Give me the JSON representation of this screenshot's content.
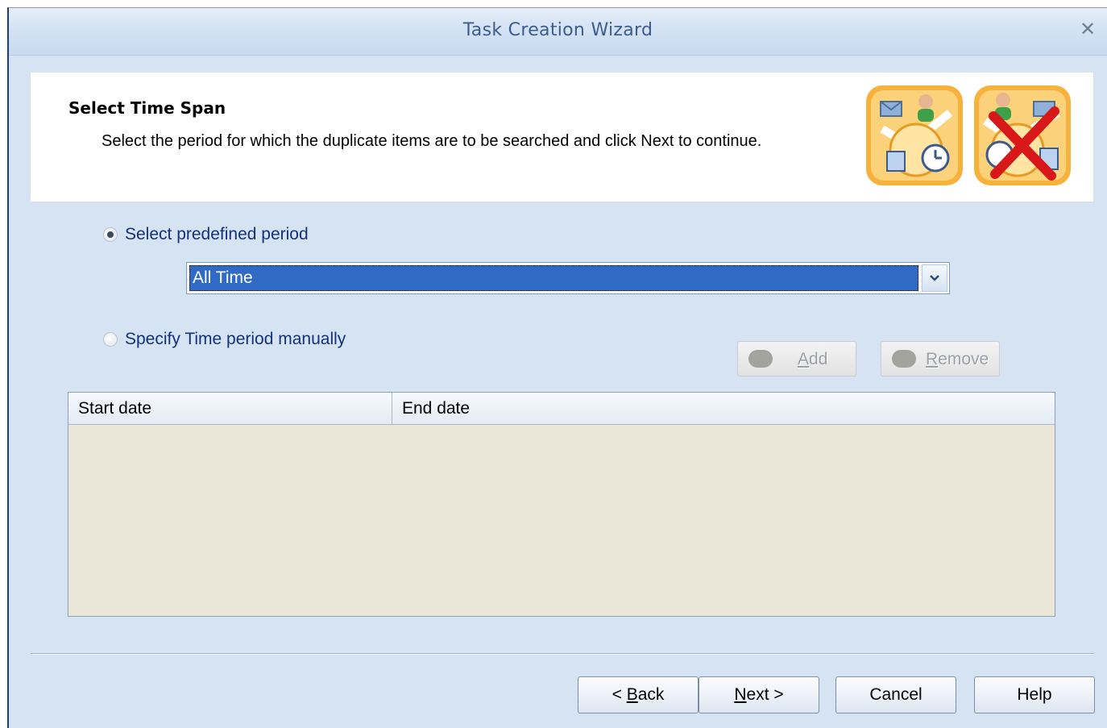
{
  "window": {
    "title": "Task Creation Wizard",
    "close_glyph": "✕"
  },
  "header": {
    "title": "Select Time Span",
    "description": "Select the period for which the duplicate items are to be searched and click Next to continue."
  },
  "options": {
    "predefined": {
      "label": "Select predefined period",
      "checked": true,
      "selected_value": "All Time"
    },
    "manual": {
      "label": "Specify Time period manually",
      "checked": false
    }
  },
  "period_buttons": {
    "add_label": "Add",
    "add_mnemonic": "A",
    "add_rest": "dd",
    "remove_label": "Remove",
    "remove_mnemonic": "R",
    "remove_rest": "emove"
  },
  "table": {
    "columns": [
      "Start date",
      "End date"
    ],
    "rows": []
  },
  "footer": {
    "back_label": "< Back",
    "back_prefix": "< ",
    "back_mnemonic": "B",
    "back_rest": "ack",
    "next_label": "Next >",
    "next_mnemonic": "N",
    "next_rest": "ext >",
    "cancel_label": "Cancel",
    "help_label": "Help"
  },
  "colors": {
    "window_bg": "#d5e3f3",
    "selection": "#316ac5",
    "grid_bg": "#ebe7d8",
    "radio_text": "#13327a"
  },
  "icons": [
    "close-icon",
    "mail-contact-clock-icon",
    "delete-duplicates-icon",
    "chevron-down-icon"
  ]
}
